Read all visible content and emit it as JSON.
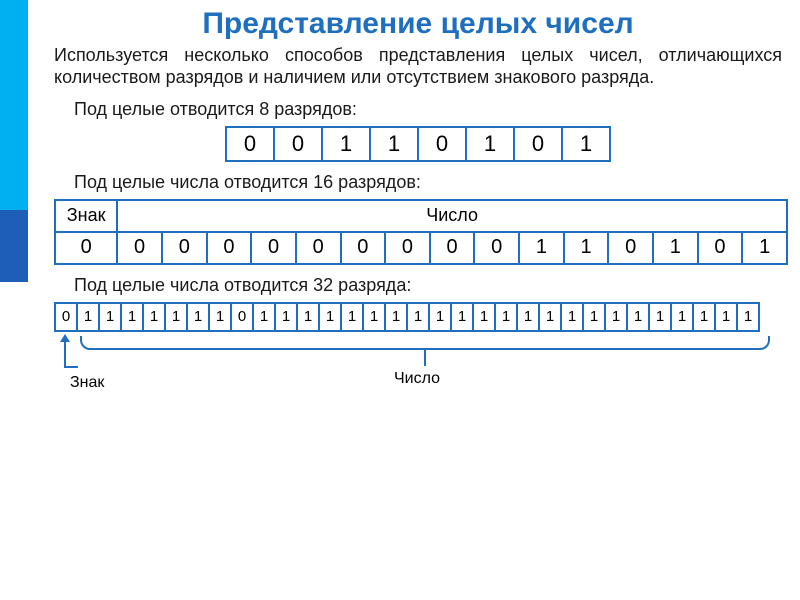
{
  "title": "Представление целых чисел",
  "intro": "Используется несколько способов представления целых чисел, отличающихся количеством разрядов и наличием или отсутствием знакового разряда.",
  "sec8": {
    "label": "Под целые отводится 8 разрядов:",
    "bits": [
      "0",
      "0",
      "1",
      "1",
      "0",
      "1",
      "0",
      "1"
    ]
  },
  "sec16": {
    "label": "Под целые числа отводится 16 разрядов:",
    "sign_header": "Знак",
    "num_header": "Число",
    "bits": [
      "0",
      "0",
      "0",
      "0",
      "0",
      "0",
      "0",
      "0",
      "0",
      "0",
      "1",
      "1",
      "0",
      "1",
      "0",
      "1"
    ]
  },
  "sec32": {
    "label": "Под целые числа отводится 32 разряда:",
    "bits": [
      "0",
      "1",
      "1",
      "1",
      "1",
      "1",
      "1",
      "1",
      "0",
      "1",
      "1",
      "1",
      "1",
      "1",
      "1",
      "1",
      "1",
      "1",
      "1",
      "1",
      "1",
      "1",
      "1",
      "1",
      "1",
      "1",
      "1",
      "1",
      "1",
      "1",
      "1",
      "1"
    ],
    "sign_annot": "Знак",
    "num_annot": "Число"
  }
}
